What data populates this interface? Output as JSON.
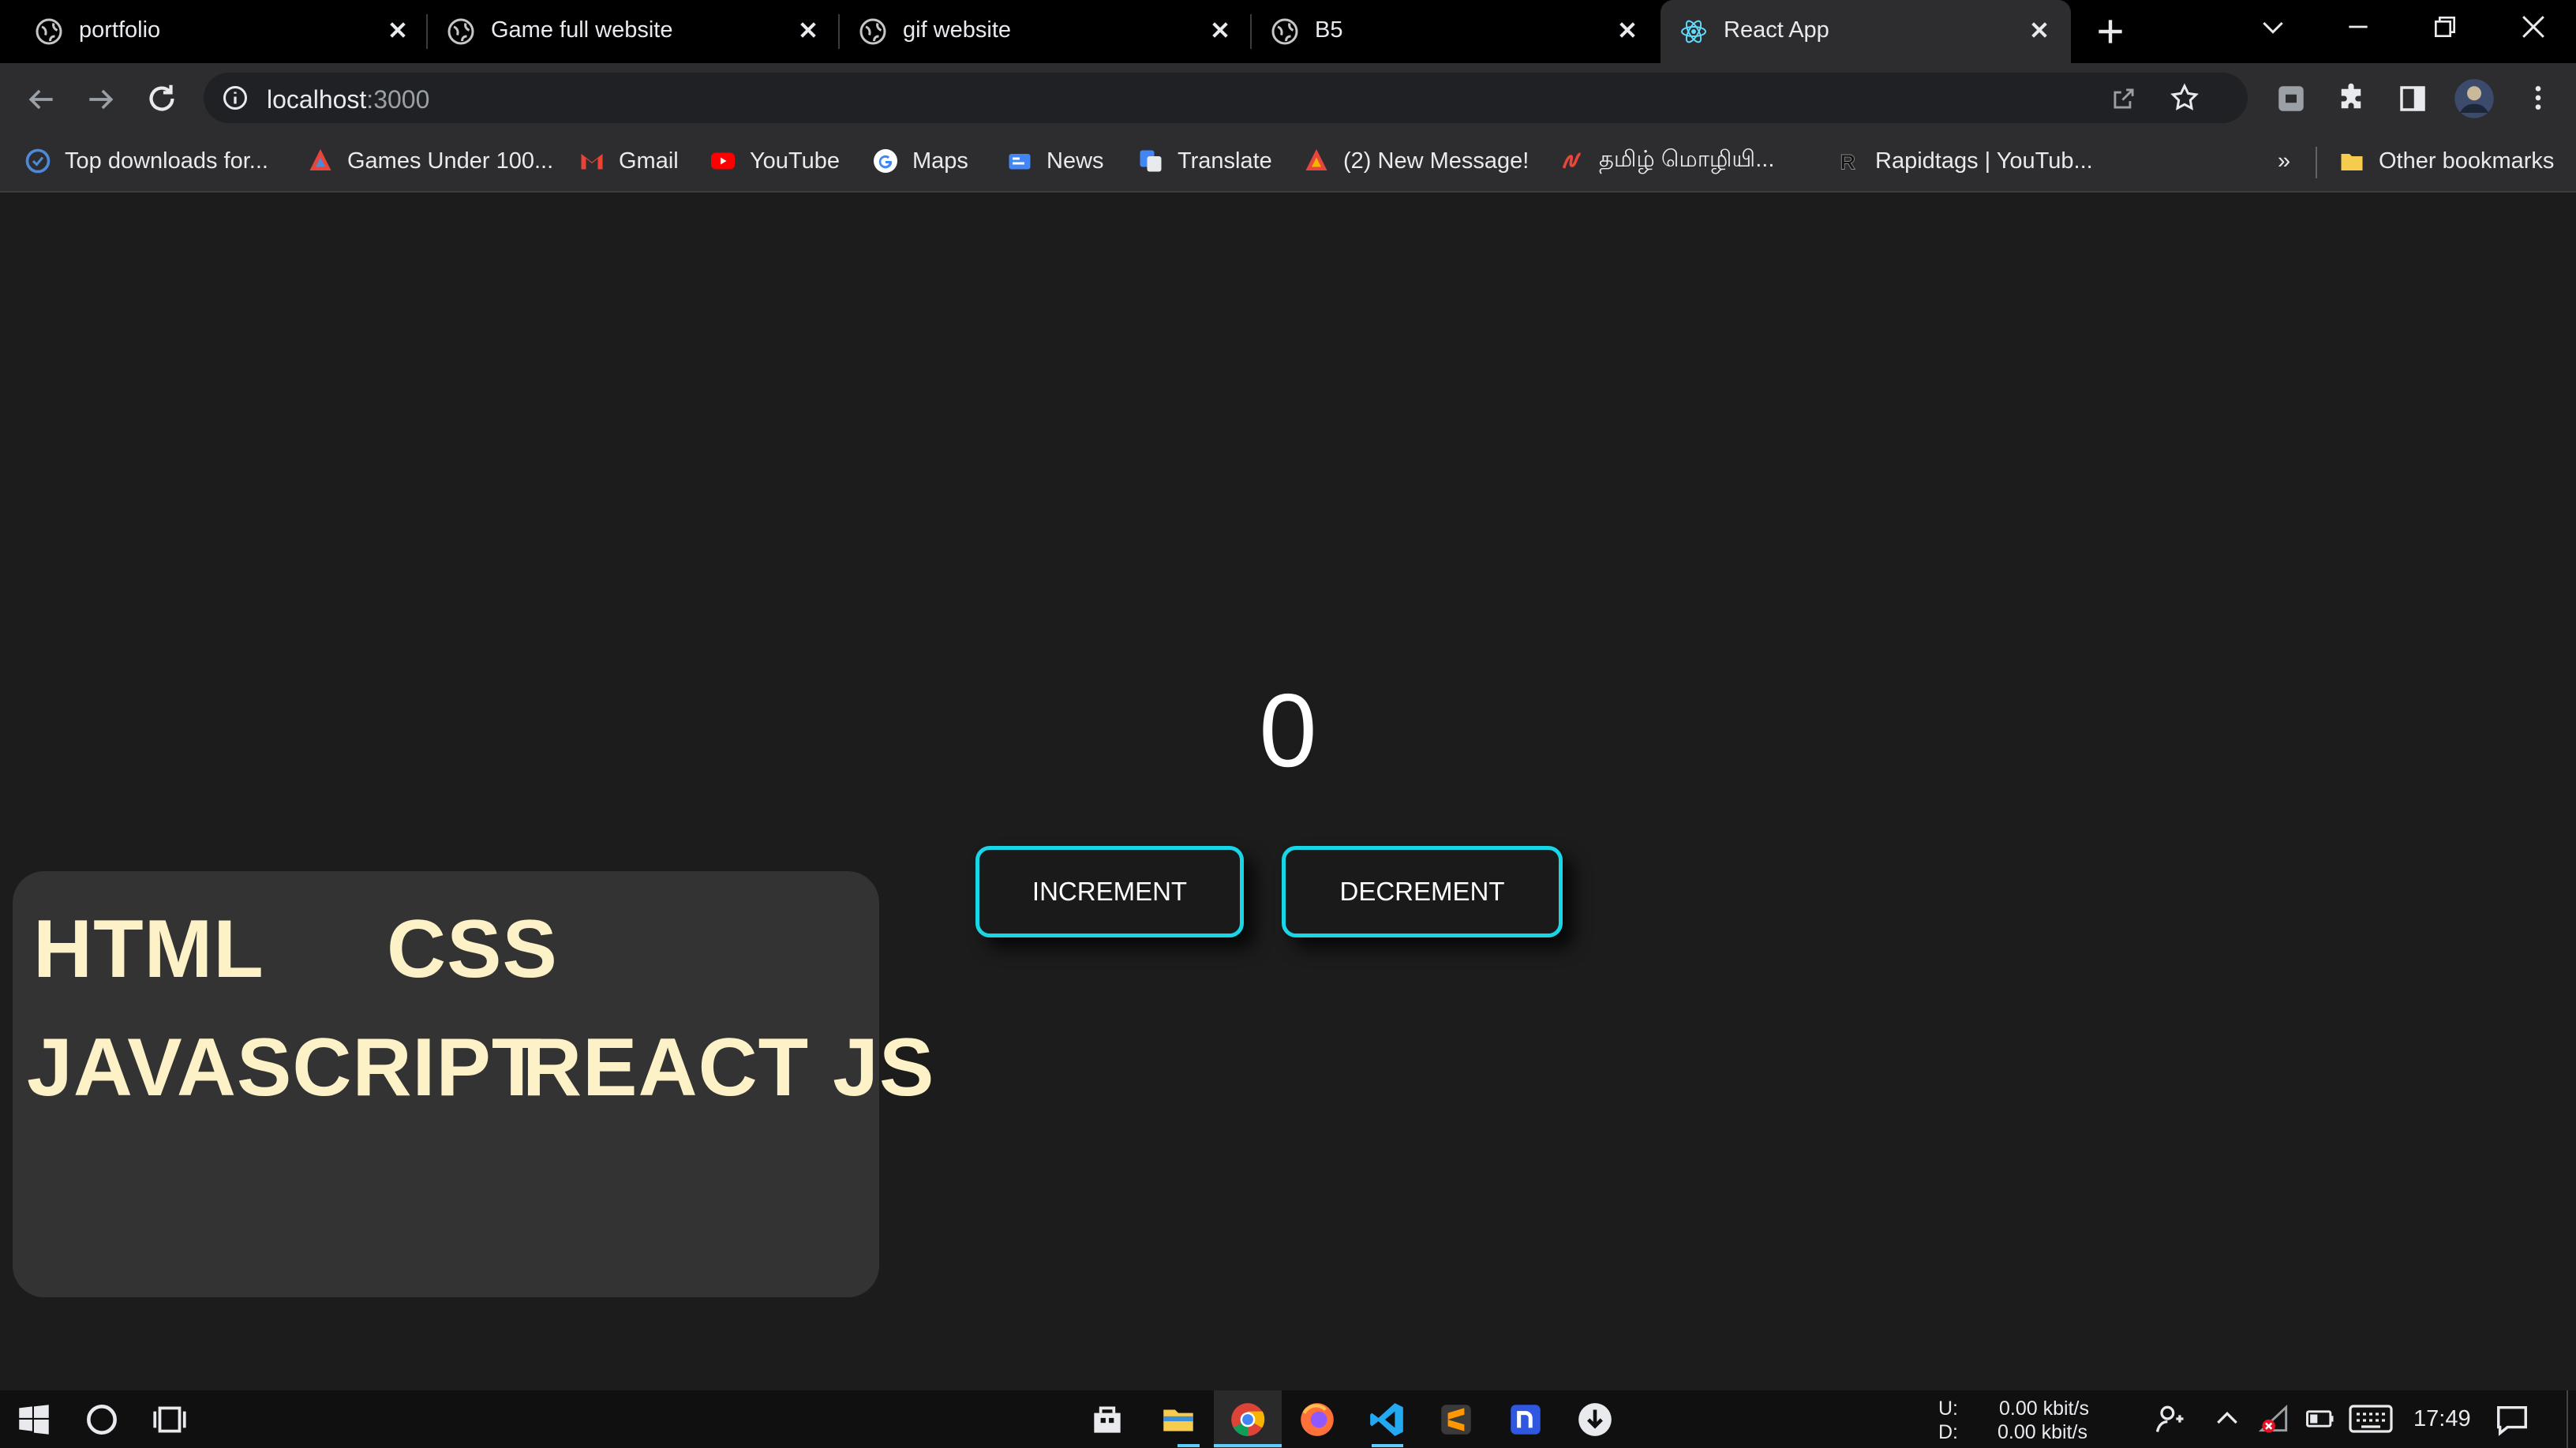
{
  "tabs": [
    {
      "title": "portfolio"
    },
    {
      "title": "Game full website"
    },
    {
      "title": "gif website"
    },
    {
      "title": "B5"
    },
    {
      "title": "React App"
    }
  ],
  "address_bar": {
    "host": "localhost",
    "port": ":3000"
  },
  "bookmarks": [
    {
      "label": "Top downloads for..."
    },
    {
      "label": "Games Under 100..."
    },
    {
      "label": "Gmail"
    },
    {
      "label": "YouTube"
    },
    {
      "label": "Maps"
    },
    {
      "label": "News"
    },
    {
      "label": "Translate"
    },
    {
      "label": "(2) New Message!"
    },
    {
      "label": "தமிழ் மொழியி..."
    },
    {
      "label": "Rapidtags | YouTub..."
    }
  ],
  "bookmarks_overflow": "»",
  "other_bookmarks": "Other bookmarks",
  "counter": {
    "value": "0",
    "increment_label": "INCREMENT",
    "decrement_label": "DECREMENT"
  },
  "skills": [
    "HTML",
    "CSS",
    "JAVASCRIPT",
    "REACT JS"
  ],
  "taskbar": {
    "net_up": "U:",
    "net_up_value": "0.00 kbit/s",
    "net_down": "D:",
    "net_down_value": "0.00 kbit/s",
    "clock": "17:49"
  },
  "colors": {
    "accent": "#19d6e6",
    "skill_text": "#fdf2c7",
    "card_bg": "#333333",
    "page_bg": "#1c1c1c"
  }
}
